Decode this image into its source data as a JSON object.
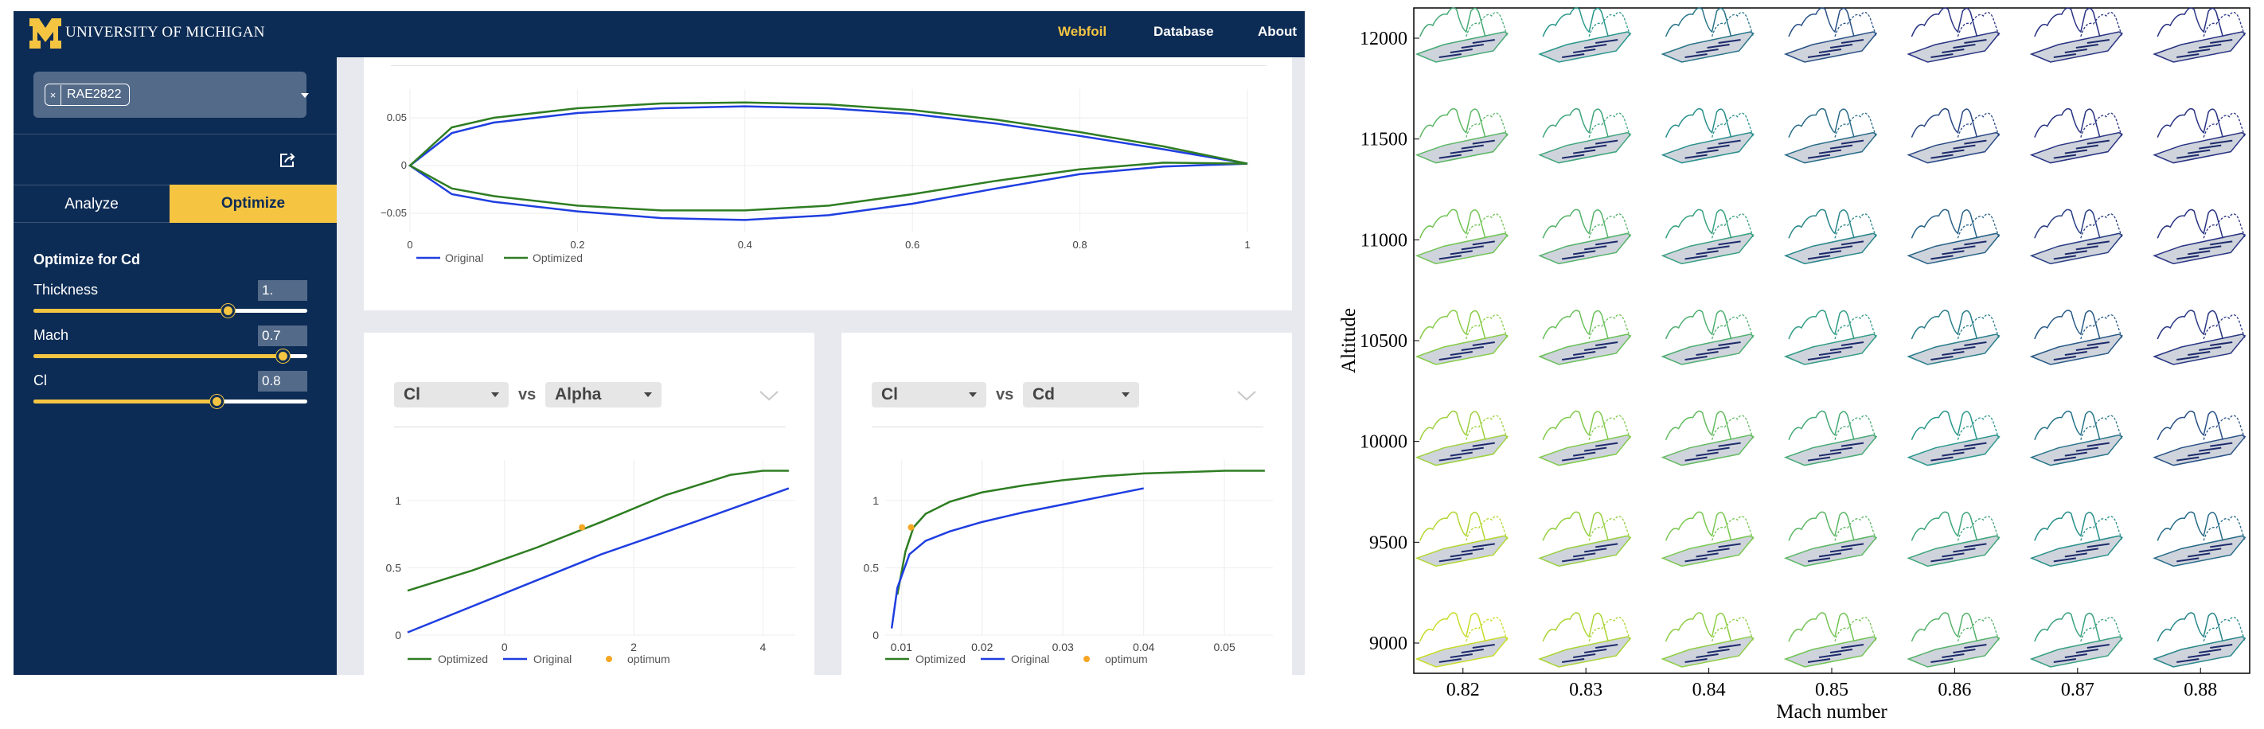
{
  "header": {
    "university": "UNIVERSITY OF MICHIGAN",
    "nav": [
      "Webfoil",
      "Database",
      "About"
    ],
    "active_nav": "Webfoil"
  },
  "sidebar": {
    "airfoil_chip": "RAE2822",
    "chip_remove": "×",
    "tabs": [
      "Analyze",
      "Optimize"
    ],
    "active_tab": "Optimize",
    "optimize_title": "Optimize for Cd",
    "params": [
      {
        "label": "Thickness",
        "value": "1.",
        "slider_fraction": 0.71
      },
      {
        "label": "Mach",
        "value": "0.7",
        "slider_fraction": 0.91
      },
      {
        "label": "Cl",
        "value": "0.8",
        "slider_fraction": 0.67
      }
    ]
  },
  "colors": {
    "navy": "#0d2c55",
    "maize": "#f5c542",
    "original": "#1f3ee0",
    "optimized": "#2e7d22",
    "optimum": "#f5a623"
  },
  "icons": {
    "share": "share-icon",
    "dropdown": "caret-down-icon",
    "collapse": "chevron-down-icon",
    "remove": "close-icon"
  },
  "airfoil_plot": {
    "legend": [
      "Original",
      "Optimized"
    ],
    "x_ticks": [
      "0",
      "0.2",
      "0.4",
      "0.6",
      "0.8",
      "1"
    ],
    "y_ticks": [
      "0.05",
      "0",
      "−0.05"
    ]
  },
  "polar_left": {
    "x_select": "Alpha",
    "y_select": "Cl",
    "vs": "vs",
    "legend": [
      "Optimized",
      "Original",
      "optimum"
    ],
    "x_ticks": [
      "0",
      "2",
      "4"
    ],
    "y_ticks": [
      "1",
      "0.5",
      "0"
    ]
  },
  "polar_right": {
    "x_select": "Cd",
    "y_select": "Cl",
    "vs": "vs",
    "legend": [
      "Optimized",
      "Original",
      "optimum"
    ],
    "x_ticks": [
      "0.01",
      "0.02",
      "0.03",
      "0.04",
      "0.05"
    ],
    "y_ticks": [
      "1",
      "0.5",
      "0"
    ]
  },
  "chart_data": [
    {
      "type": "line",
      "x": [
        0,
        0.05,
        0.1,
        0.2,
        0.3,
        0.4,
        0.5,
        0.6,
        0.7,
        0.8,
        0.9,
        1.0
      ],
      "series": [
        {
          "name": "Original",
          "upper": [
            0,
            0.034,
            0.045,
            0.055,
            0.06,
            0.062,
            0.06,
            0.054,
            0.044,
            0.031,
            0.017,
            0.002
          ],
          "lower": [
            0,
            -0.03,
            -0.038,
            -0.048,
            -0.055,
            -0.057,
            -0.052,
            -0.04,
            -0.024,
            -0.009,
            -0.001,
            0.002
          ]
        },
        {
          "name": "Optimized",
          "upper": [
            0,
            0.04,
            0.05,
            0.06,
            0.065,
            0.066,
            0.064,
            0.058,
            0.048,
            0.035,
            0.02,
            0.002
          ],
          "lower": [
            0,
            -0.024,
            -0.032,
            -0.042,
            -0.047,
            -0.047,
            -0.042,
            -0.03,
            -0.016,
            -0.004,
            0.003,
            0.002
          ]
        }
      ],
      "xlim": [
        0,
        1
      ],
      "ylim": [
        -0.07,
        0.08
      ]
    },
    {
      "type": "line",
      "xlabel": "Alpha",
      "ylabel": "Cl",
      "series": [
        {
          "name": "Optimized",
          "x": [
            -1.5,
            -0.5,
            0.5,
            1.5,
            2.5,
            3.5,
            4.0,
            4.4
          ],
          "y": [
            0.33,
            0.48,
            0.65,
            0.84,
            1.04,
            1.19,
            1.22,
            1.22
          ]
        },
        {
          "name": "Original",
          "x": [
            -1.5,
            0,
            1.5,
            3,
            4.4
          ],
          "y": [
            0.02,
            0.31,
            0.6,
            0.85,
            1.09
          ]
        },
        {
          "name": "optimum",
          "x": [
            1.2
          ],
          "y": [
            0.8
          ]
        }
      ],
      "xlim": [
        -1.5,
        4.5
      ],
      "ylim": [
        0,
        1.3
      ]
    },
    {
      "type": "line",
      "xlabel": "Cd",
      "ylabel": "Cl",
      "series": [
        {
          "name": "Optimized",
          "x": [
            0.0095,
            0.0105,
            0.0115,
            0.013,
            0.016,
            0.02,
            0.025,
            0.03,
            0.035,
            0.04,
            0.045,
            0.05,
            0.055
          ],
          "y": [
            0.3,
            0.62,
            0.8,
            0.9,
            0.99,
            1.06,
            1.11,
            1.15,
            1.18,
            1.2,
            1.21,
            1.22,
            1.22
          ]
        },
        {
          "name": "Original",
          "x": [
            0.0088,
            0.0095,
            0.011,
            0.013,
            0.016,
            0.02,
            0.025,
            0.03,
            0.035,
            0.04
          ],
          "y": [
            0.05,
            0.35,
            0.6,
            0.7,
            0.77,
            0.84,
            0.91,
            0.97,
            1.03,
            1.09
          ]
        },
        {
          "name": "optimum",
          "x": [
            0.0112
          ],
          "y": [
            0.8
          ]
        }
      ],
      "xlim": [
        0.008,
        0.056
      ],
      "ylim": [
        0,
        1.3
      ]
    },
    {
      "type": "scatter",
      "xlabel": "Mach number",
      "ylabel": "Altitude",
      "x_ticks": [
        "0.82",
        "0.83",
        "0.84",
        "0.85",
        "0.86",
        "0.87",
        "0.88"
      ],
      "y_ticks": [
        "12000",
        "11500",
        "11000",
        "10500",
        "10000",
        "9500",
        "9000"
      ],
      "xlim": [
        0.816,
        0.884
      ],
      "ylim": [
        8850,
        12150
      ],
      "x": [
        0.82,
        0.83,
        0.84,
        0.85,
        0.86,
        0.87,
        0.88
      ],
      "y": [
        9000,
        9500,
        10000,
        10500,
        11000,
        11500,
        12000
      ]
    }
  ]
}
